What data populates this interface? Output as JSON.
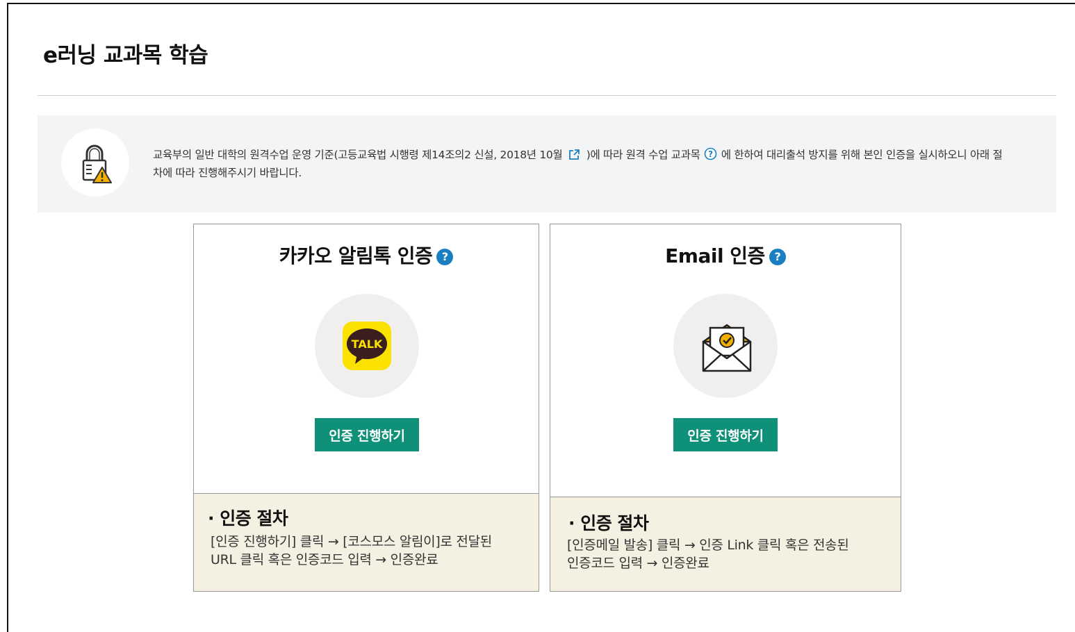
{
  "page": {
    "title": "e러닝 교과목 학습"
  },
  "notice": {
    "text_part1": "교육부의 일반 대학의 원격수업 운영 기준(고등교육법 시행령 제14조의2 신설, 2018년 10월",
    "text_part2": ")에 따라 원격 수업 교과목",
    "text_part3": "에 한하여 대리출석 방지를 위해 본인 인증을 실시하오니 아래 절차에 따라 진행해주시기 바랍니다.",
    "icon": "lock-warning-icon",
    "link_icon": "external-link-icon",
    "help_icon": "help-circle-icon"
  },
  "cards": {
    "kakao": {
      "title": "카카오 알림톡 인증",
      "help": "?",
      "icon": "kakaotalk-icon",
      "icon_text": "TALK",
      "button_label": "인증 진행하기",
      "proc_title": "· 인증 절차",
      "proc_line1": "[인증 진행하기] 클릭 → [코스모스 알림이]로 전달된",
      "proc_line2": "URL 클릭 혹은 인증코드 입력 → 인증완료"
    },
    "email": {
      "title": "Email 인증",
      "help": "?",
      "icon": "envelope-icon",
      "button_label": "인증 진행하기",
      "proc_title": "· 인증 절차",
      "proc_line1": "[인증메일 발송] 클릭 → 인증 Link 클릭 혹은 전송된",
      "proc_line2": "인증코드 입력 → 인증완료"
    }
  },
  "colors": {
    "accent_green": "#0f9079",
    "help_blue": "#1a7fc2",
    "kakao_yellow": "#fae100",
    "proc_bg": "#f5f1e2"
  }
}
